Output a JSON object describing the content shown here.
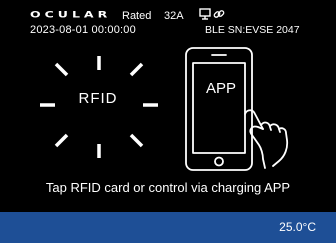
{
  "header": {
    "brand": "OCULAR",
    "rated_label": "Rated",
    "rated_value": "32A",
    "datetime": "2023-08-01  00:00:00",
    "ble_sn": "BLE SN:EVSE 2047",
    "icons": [
      "monitor-icon",
      "link-icon"
    ]
  },
  "rfid": {
    "label": "RFID",
    "icon": "rfid-burst-icon"
  },
  "app": {
    "label": "APP",
    "icon": "phone-with-hand-icon"
  },
  "hint": "Tap RFID card or control via charging APP",
  "status": {
    "temperature": "25.0°C"
  },
  "colors": {
    "background": "#000000",
    "status_bar": "#1e4f96",
    "text": "#ffffff"
  }
}
